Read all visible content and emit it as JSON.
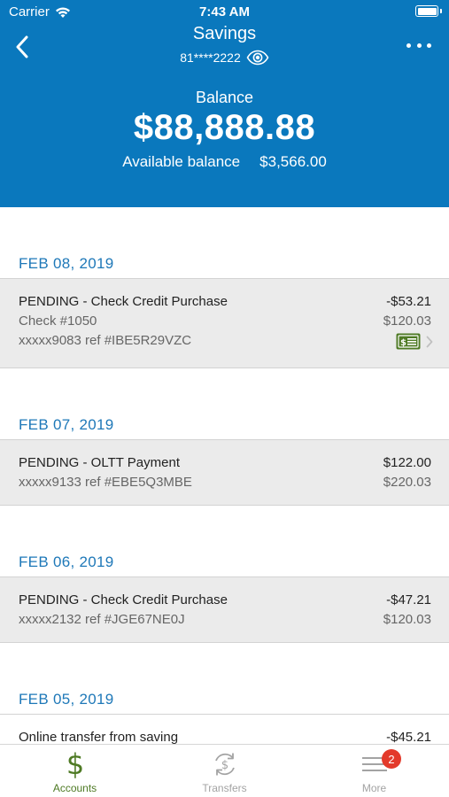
{
  "status_bar": {
    "carrier": "Carrier",
    "time": "7:43 AM"
  },
  "header": {
    "title": "Savings",
    "account_masked": "81****2222",
    "balance_label": "Balance",
    "balance": "$88,888.88",
    "available_label": "Available balance",
    "available_amount": "$3,566.00"
  },
  "groups": [
    {
      "date": "FEB 08, 2019",
      "transactions": [
        {
          "line1": "PENDING - Check Credit Purchase",
          "line2": "Check #1050",
          "line3": "xxxxx9083 ref #IBE5R29VZC",
          "amount": "-$53.21",
          "balance": "$120.03",
          "icons": [
            "check-image-icon",
            "chevron-right-icon"
          ]
        }
      ]
    },
    {
      "date": "FEB 07, 2019",
      "transactions": [
        {
          "line1": "PENDING - OLTT Payment",
          "line2": "xxxxx9133 ref #EBE5Q3MBE",
          "amount": "$122.00",
          "balance": "$220.03"
        }
      ]
    },
    {
      "date": "FEB 06, 2019",
      "transactions": [
        {
          "line1": "PENDING - Check Credit Purchase",
          "line2": "xxxxx2132 ref #JGE67NE0J",
          "amount": "-$47.21",
          "balance": "$120.03"
        }
      ]
    },
    {
      "date": "FEB 05, 2019",
      "transactions": [
        {
          "line1": "Online transfer from saving",
          "amount": "-$45.21"
        }
      ]
    }
  ],
  "tabs": [
    {
      "label": "Accounts",
      "icon": "dollar-icon",
      "active": true
    },
    {
      "label": "Transfers",
      "icon": "transfer-icon",
      "active": false
    },
    {
      "label": "More",
      "icon": "menu-icon",
      "active": false,
      "badge": "2"
    }
  ],
  "colors": {
    "header_bg": "#0a78bd",
    "date_text": "#1e78b8",
    "active_tab": "#4e7a24",
    "badge": "#e33a2b",
    "check_icon": "#4e7a24"
  }
}
